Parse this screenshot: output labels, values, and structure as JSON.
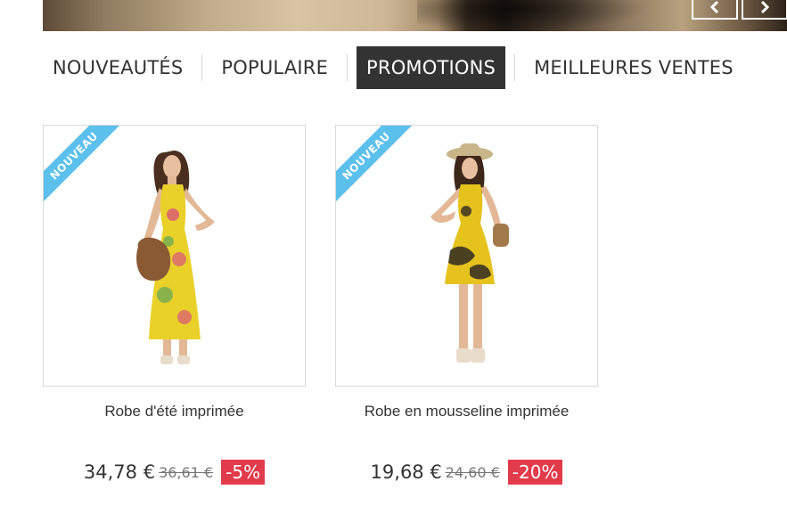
{
  "slider": {
    "prev_icon": "chevron-left-icon",
    "next_icon": "chevron-right-icon"
  },
  "tabs": [
    {
      "label": "NOUVEAUTÉS",
      "active": false
    },
    {
      "label": "POPULAIRE",
      "active": false
    },
    {
      "label": "PROMOTIONS",
      "active": true
    },
    {
      "label": "MEILLEURES VENTES",
      "active": false
    }
  ],
  "products": [
    {
      "badge": "NOUVEAU",
      "name": "Robe d'été imprimée",
      "price": "34,78 €",
      "old_price": "36,61 €",
      "discount": "-5%",
      "dress_color": "#e9d12a"
    },
    {
      "badge": "NOUVEAU",
      "name": "Robe en mousseline imprimée",
      "price": "19,68 €",
      "old_price": "24,60 €",
      "discount": "-20%",
      "dress_color": "#e6c21d"
    }
  ],
  "colors": {
    "badge": "#5bc0eb",
    "discount": "#e23b4b",
    "active_tab": "#333333"
  }
}
